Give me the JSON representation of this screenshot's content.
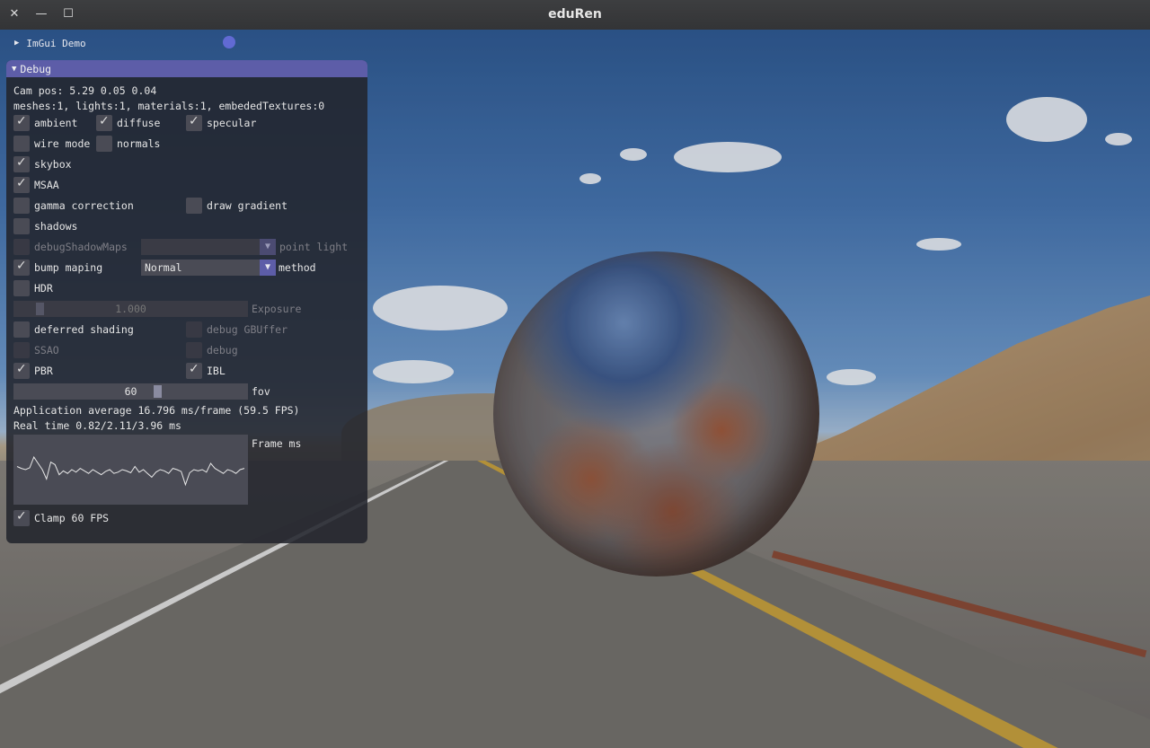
{
  "window": {
    "title": "eduRen",
    "close_glyph": "✕",
    "minimize_glyph": "—",
    "maximize_glyph": "☐"
  },
  "imgui_demo": {
    "label": "ImGui Demo",
    "arrow": "▶"
  },
  "debug_panel": {
    "title": "Debug",
    "cam_pos": "Cam pos: 5.29 0.05 0.04",
    "scene_info": "meshes:1, lights:1, materials:1, embededTextures:0",
    "checkboxes": {
      "ambient": {
        "label": "ambient",
        "checked": true
      },
      "diffuse": {
        "label": "diffuse",
        "checked": true
      },
      "specular": {
        "label": "specular",
        "checked": true
      },
      "wire_mode": {
        "label": "wire mode",
        "checked": false
      },
      "normals": {
        "label": "normals",
        "checked": false
      },
      "skybox": {
        "label": "skybox",
        "checked": true
      },
      "msaa": {
        "label": "MSAA",
        "checked": true
      },
      "gamma_correction": {
        "label": "gamma correction",
        "checked": false
      },
      "draw_gradient": {
        "label": "draw gradient",
        "checked": false
      },
      "shadows": {
        "label": "shadows",
        "checked": false
      },
      "debug_shadow_maps": {
        "label": "debugShadowMaps",
        "checked": false,
        "disabled": true
      },
      "bump_maping": {
        "label": "bump maping",
        "checked": true
      },
      "hdr": {
        "label": "HDR",
        "checked": false
      },
      "deferred_shading": {
        "label": "deferred shading",
        "checked": false
      },
      "debug_gbuffer": {
        "label": "debug GBUffer",
        "checked": false,
        "disabled": true
      },
      "ssao": {
        "label": "SSAO",
        "checked": false,
        "disabled": true
      },
      "debug": {
        "label": "debug",
        "checked": false,
        "disabled": true
      },
      "pbr": {
        "label": "PBR",
        "checked": true
      },
      "ibl": {
        "label": "IBL",
        "checked": true
      },
      "clamp_fps": {
        "label": "Clamp 60 FPS",
        "checked": true
      }
    },
    "point_light_combo": {
      "value": "",
      "label": "point light",
      "disabled": true
    },
    "method_combo": {
      "value": "Normal",
      "label": "method"
    },
    "exposure_slider": {
      "value": "1.000",
      "label": "Exposure",
      "disabled": true,
      "fraction": 0.1
    },
    "fov_slider": {
      "value": "60",
      "label": "fov",
      "fraction": 0.62
    },
    "combo_arrow": "▼",
    "app_avg": "Application average 16.796 ms/frame (59.5 FPS)",
    "real_time": "Real time 0.82/2.11/3.96 ms",
    "frame_plot": {
      "label": "Frame ms",
      "values": [
        0.55,
        0.52,
        0.5,
        0.53,
        0.7,
        0.6,
        0.5,
        0.35,
        0.62,
        0.58,
        0.42,
        0.48,
        0.44,
        0.5,
        0.46,
        0.52,
        0.48,
        0.44,
        0.5,
        0.46,
        0.42,
        0.47,
        0.5,
        0.44,
        0.46,
        0.5,
        0.48,
        0.45,
        0.55,
        0.46,
        0.5,
        0.44,
        0.38,
        0.46,
        0.5,
        0.48,
        0.44,
        0.52,
        0.5,
        0.47,
        0.26,
        0.45,
        0.5,
        0.48,
        0.5,
        0.46,
        0.6,
        0.52,
        0.48,
        0.44,
        0.5,
        0.48,
        0.44,
        0.5,
        0.52
      ]
    }
  },
  "colors": {
    "accent": "#5d5da8",
    "panel_bg": "#22242c",
    "widget_bg": "#4a4b55"
  }
}
